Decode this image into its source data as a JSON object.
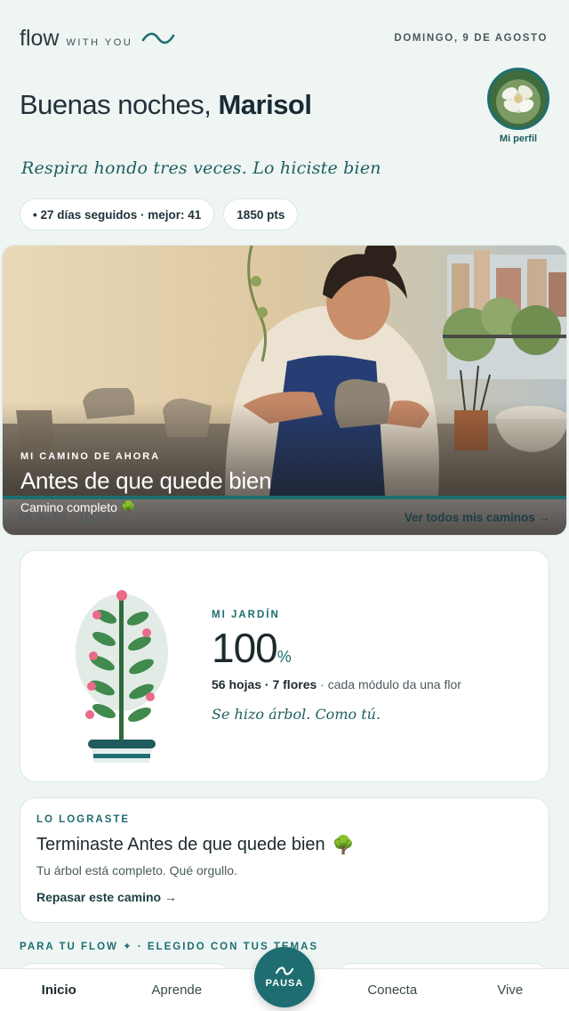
{
  "brand": {
    "name": "flow",
    "tagline": "WITH YOU"
  },
  "date": "DOMINGO, 9 DE AGOSTO",
  "greeting": {
    "prefix": "Buenas noches,",
    "name": "Marisol"
  },
  "profile": {
    "label": "Mi perfil"
  },
  "quote": "Respira hondo tres veces. Lo hiciste bien",
  "chips": {
    "streak": "• 27 días seguidos · mejor: 41",
    "points": "1850 pts"
  },
  "current_path": {
    "kicker": "MI CAMINO DE AHORA",
    "title": "Antes de que quede bien",
    "status": "Camino completo 🌳",
    "progress_text": "56 de 56 · 100%",
    "progress": 1.0,
    "link": "Ver todos mis caminos →"
  },
  "garden": {
    "kicker": "MI JARDÍN",
    "percent": "100",
    "percent_sign": "%",
    "stats_bold": "56 hojas · 7 flores",
    "stats_rest": " · cada módulo da una flor",
    "note": "Se hizo árbol. Como tú."
  },
  "done": {
    "kicker": "LO LOGRASTE",
    "title": "Terminaste Antes de que quede bien",
    "title_icon": "🌳",
    "sub": "Tu árbol está completo. Qué orgullo.",
    "link": "Repasar este camino →"
  },
  "for_you": "PARA TU FLOW ✦ · ELEGIDO CON TUS TEMAS",
  "nav": {
    "home": "Inicio",
    "learn": "Aprende",
    "pause": "PAUSA",
    "connect": "Conecta",
    "live": "Vive"
  },
  "colors": {
    "accent": "#1e6d70",
    "background": "#eef5f3"
  }
}
